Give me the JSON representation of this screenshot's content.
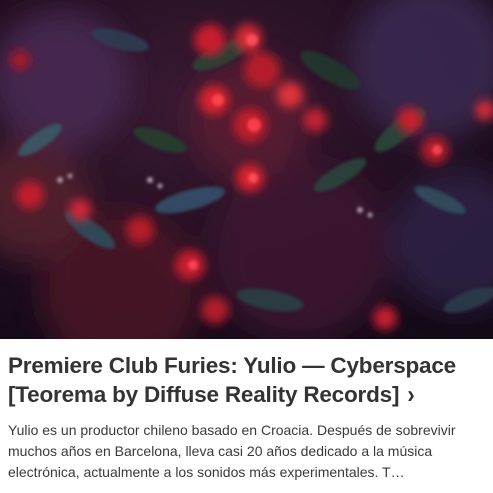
{
  "article": {
    "image_alt": "Flores rojas y follaje oscuro",
    "title": "Premiere Club Furies: Yulio — Cyberspace [Teorema by Diffuse Reality Records]",
    "chevron": "›",
    "excerpt": "Yulio es un productor chileno basado en Croacia. Después de sobrevivir muchos años en Barcelona, lleva casi 20 años dedicado a la música electrónica, actualmente a los sonidos más experimentales. T…"
  },
  "colors": {
    "title": "#333333",
    "text": "#3a3a3a",
    "image_base": "#2a1224",
    "flower_red": "#d8232f"
  }
}
